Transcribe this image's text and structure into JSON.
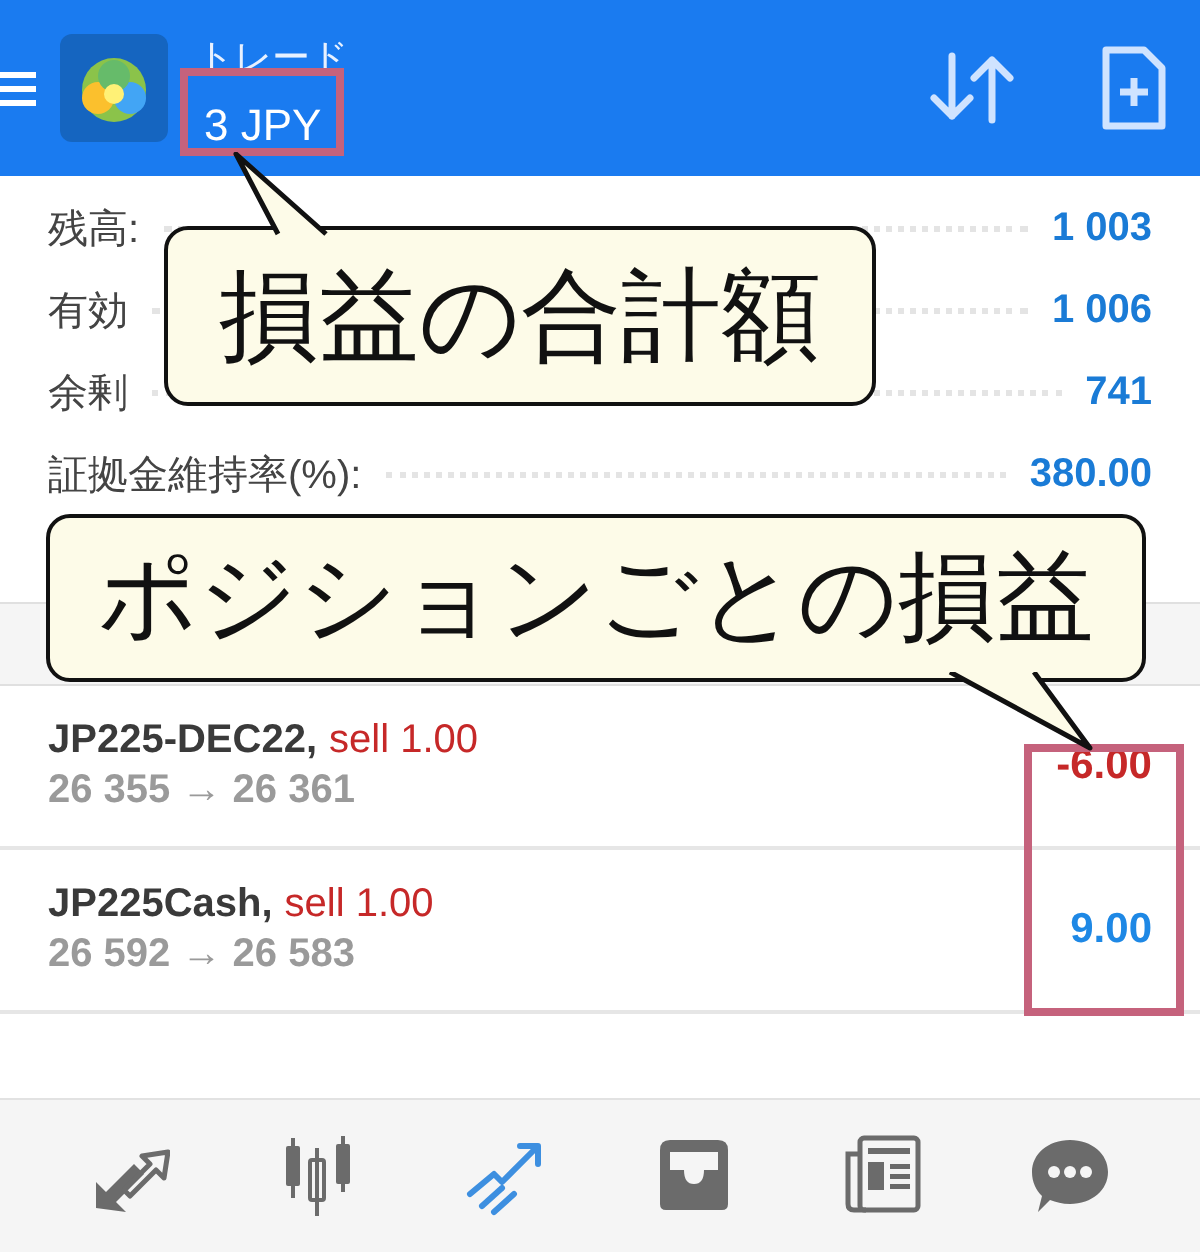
{
  "app_bar": {
    "title": "トレード",
    "subtitle": "3 JPY"
  },
  "account": [
    {
      "label": "残高:",
      "value": "1 003"
    },
    {
      "label": "有効",
      "value": "1 006"
    },
    {
      "label": "余剰",
      "value": "741"
    },
    {
      "label": "証拠金維持率(%):",
      "value": "380.00"
    }
  ],
  "positions": [
    {
      "symbol": "JP225-DEC22,",
      "side": "sell 1.00",
      "prices": "26 355 → 26 361",
      "profit": "-6.00",
      "color": "#c62828"
    },
    {
      "symbol": "JP225Cash,",
      "side": "sell 1.00",
      "prices": "26 592 → 26 583",
      "profit": "9.00",
      "color": "#1e88e5"
    }
  ],
  "nav": [
    {
      "kind": "trade-arrows",
      "selected": false
    },
    {
      "kind": "candles",
      "selected": false
    },
    {
      "kind": "trend",
      "selected": true
    },
    {
      "kind": "inbox",
      "selected": false
    },
    {
      "kind": "news",
      "selected": false
    },
    {
      "kind": "chat",
      "selected": false
    }
  ],
  "callouts": [
    {
      "text": "損益の合計額"
    },
    {
      "text": "ポジションごとの損益"
    }
  ]
}
